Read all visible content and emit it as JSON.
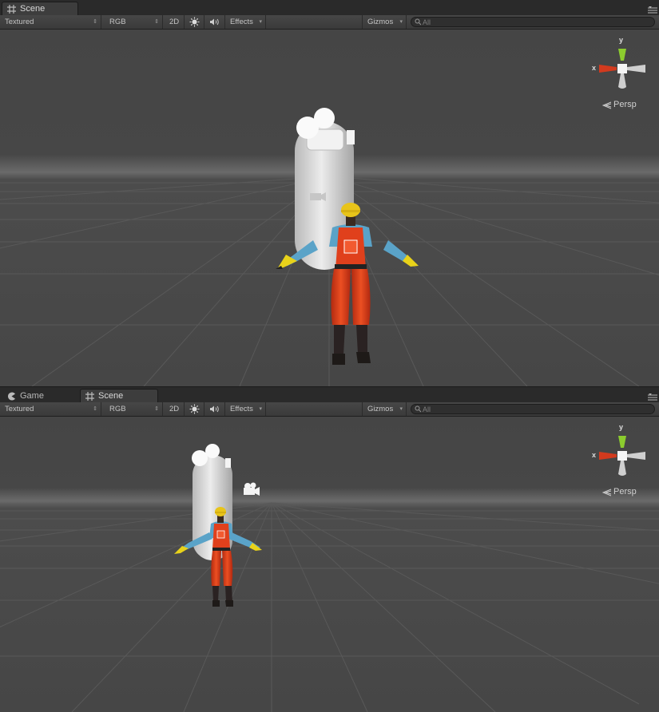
{
  "panels": [
    {
      "tabs": [
        {
          "label": "Scene",
          "icon": "scene-grid-icon"
        }
      ],
      "toolbar": {
        "shading_mode": "Textured",
        "render_mode": "RGB",
        "mode_2d": "2D",
        "lighting_icon": "sun-icon",
        "audio_icon": "speaker-icon",
        "effects": "Effects",
        "gizmos": "Gizmos",
        "search_placeholder": "All"
      },
      "gizmo": {
        "x_label": "x",
        "y_label": "y",
        "projection": "Persp"
      }
    },
    {
      "tabs": [
        {
          "label": "Game",
          "icon": "game-pacman-icon"
        },
        {
          "label": "Scene",
          "icon": "scene-grid-icon"
        }
      ],
      "toolbar": {
        "shading_mode": "Textured",
        "render_mode": "RGB",
        "mode_2d": "2D",
        "lighting_icon": "sun-icon",
        "audio_icon": "speaker-icon",
        "effects": "Effects",
        "gizmos": "Gizmos",
        "search_placeholder": "All"
      },
      "gizmo": {
        "x_label": "x",
        "y_label": "y",
        "projection": "Persp"
      }
    }
  ],
  "colors": {
    "viewport_bg": "#474747",
    "grid": "#5a5a5a",
    "gizmo_x": "#d23a1e",
    "gizmo_y": "#8ccc2e",
    "capsule": "#d4d4d4",
    "overalls": "#e0401c",
    "shirt": "#5aa3c8",
    "helmet": "#e8c41a"
  }
}
